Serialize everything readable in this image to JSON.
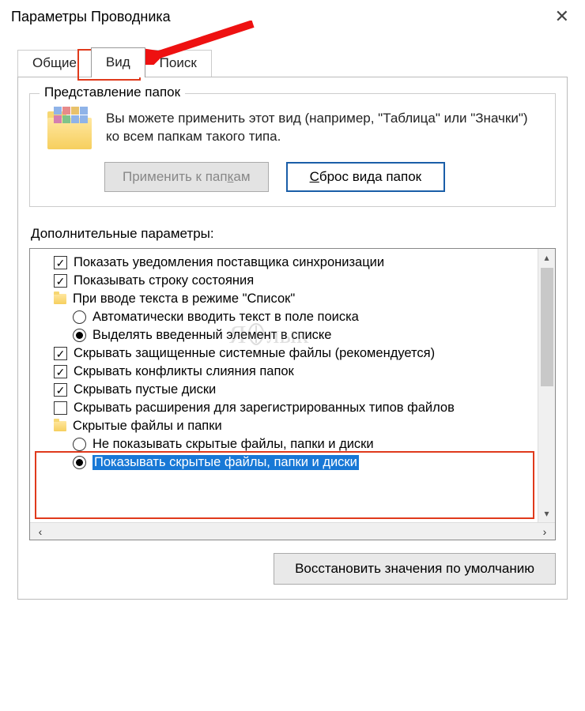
{
  "window": {
    "title": "Параметры Проводника"
  },
  "tabs": {
    "general": "Общие",
    "view": "Вид",
    "search": "Поиск"
  },
  "folder_views": {
    "legend": "Представление папок",
    "description": "Вы можете применить этот вид (например, \"Таблица\" или \"Значки\") ко всем папкам такого типа.",
    "apply_btn": "Применить к папкам",
    "apply_underline": "к",
    "reset_btn": "Сброс вида папок",
    "reset_underline": "С"
  },
  "advanced": {
    "label": "Дополнительные параметры:",
    "items": [
      {
        "type": "checkbox",
        "checked": true,
        "text": "Показать уведомления поставщика синхронизации"
      },
      {
        "type": "checkbox",
        "checked": true,
        "text": "Показывать строку состояния"
      },
      {
        "type": "folder",
        "text": "При вводе текста в режиме \"Список\""
      },
      {
        "type": "radio",
        "checked": false,
        "text": "Автоматически вводить текст в поле поиска"
      },
      {
        "type": "radio",
        "checked": true,
        "text": "Выделять введенный элемент в списке"
      },
      {
        "type": "checkbox",
        "checked": true,
        "text": "Скрывать защищенные системные файлы (рекомендуется)"
      },
      {
        "type": "checkbox",
        "checked": true,
        "text": "Скрывать конфликты слияния папок"
      },
      {
        "type": "checkbox",
        "checked": true,
        "text": "Скрывать пустые диски"
      },
      {
        "type": "checkbox",
        "checked": false,
        "text": "Скрывать расширения для зарегистрированных типов файлов"
      },
      {
        "type": "folder",
        "text": "Скрытые файлы и папки"
      },
      {
        "type": "radio",
        "checked": false,
        "text": "Не показывать скрытые файлы, папки и диски"
      },
      {
        "type": "radio",
        "checked": true,
        "selected": true,
        "text": "Показывать скрытые файлы, папки и диски"
      }
    ]
  },
  "restore_defaults": "Восстановить значения по умолчанию",
  "watermark": "Я лык"
}
